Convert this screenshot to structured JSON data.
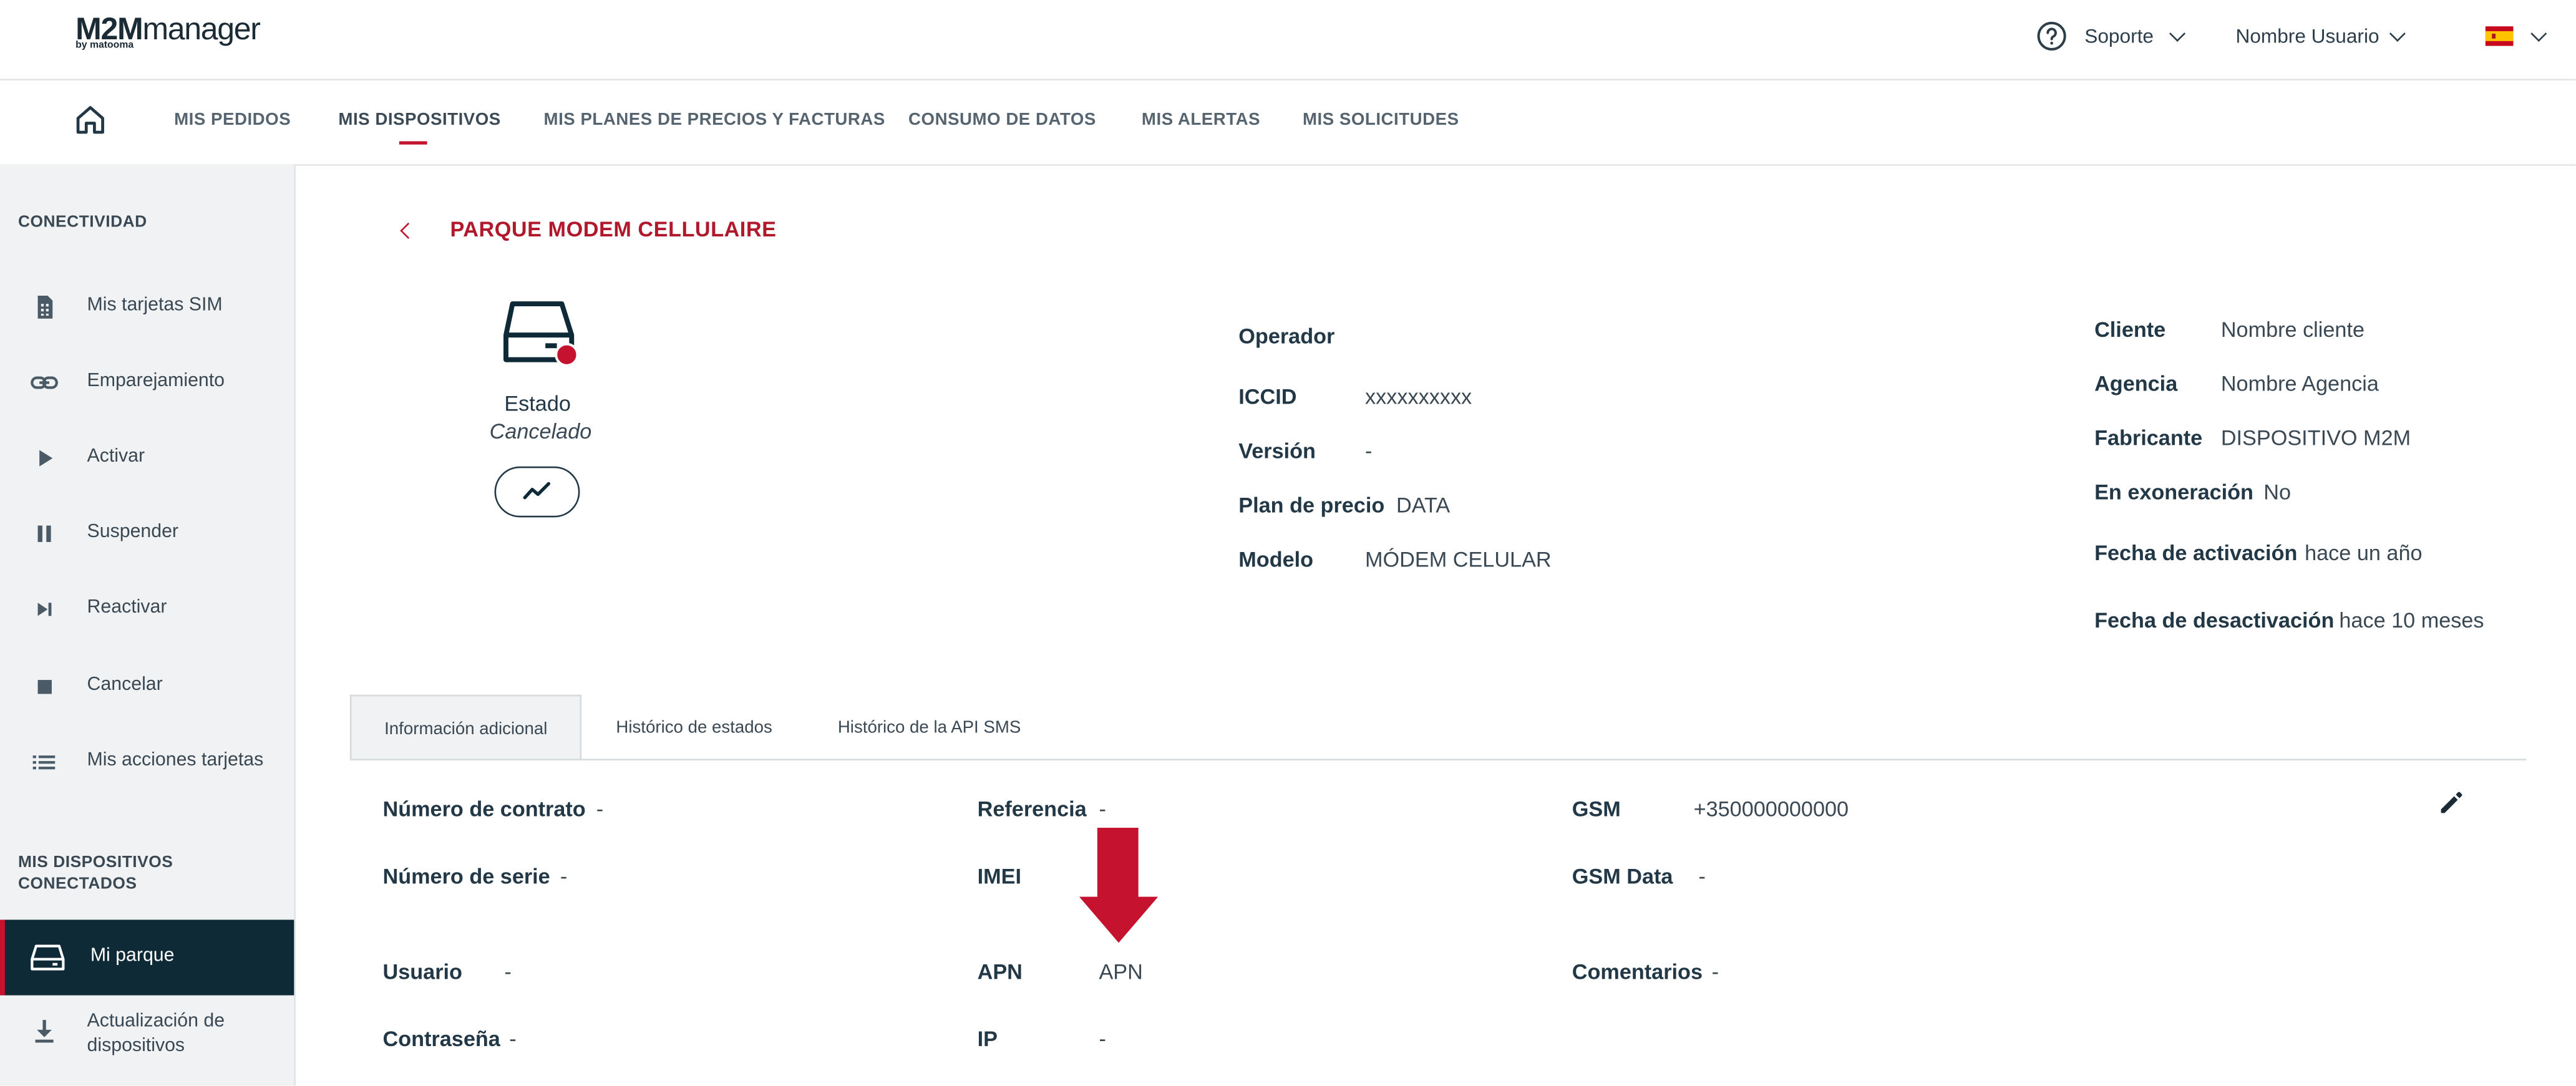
{
  "brand": {
    "logo_bold": "M2M",
    "logo_thin": "manager",
    "logo_sub": "by matooma"
  },
  "header": {
    "support_label": "Soporte",
    "user_label": "Nombre Usuario",
    "language": "es"
  },
  "nav": {
    "items": [
      {
        "label": "MIS PEDIDOS"
      },
      {
        "label": "MIS DISPOSITIVOS"
      },
      {
        "label": "MIS PLANES DE PRECIOS Y FACTURAS"
      },
      {
        "label": "CONSUMO DE DATOS"
      },
      {
        "label": "MIS ALERTAS"
      },
      {
        "label": "MIS SOLICITUDES"
      }
    ],
    "active": "MIS DISPOSITIVOS"
  },
  "sidebar": {
    "section1": "CONECTIVIDAD",
    "items": [
      {
        "label": "Mis tarjetas SIM",
        "icon": "sim-card-icon"
      },
      {
        "label": "Emparejamiento",
        "icon": "link-icon"
      },
      {
        "label": "Activar",
        "icon": "play-icon"
      },
      {
        "label": "Suspender",
        "icon": "pause-icon"
      },
      {
        "label": "Reactivar",
        "icon": "skip-next-icon"
      },
      {
        "label": "Cancelar",
        "icon": "stop-icon"
      },
      {
        "label": "Mis acciones tarjetas",
        "icon": "list-icon"
      }
    ],
    "section2_line1": "MIS DISPOSITIVOS",
    "section2_line2": "CONECTADOS",
    "items2": [
      {
        "label": "Mi parque",
        "icon": "device-icon",
        "active": true
      },
      {
        "label_line1": "Actualización de",
        "label_line2": "dispositivos",
        "icon": "download-icon"
      }
    ]
  },
  "page": {
    "title": "PARQUE MODEM CELLULAIRE",
    "device": {
      "state_label": "Estado",
      "state_value": "Cancelado"
    },
    "col2": {
      "operador_label": "Operador",
      "iccid_label": "ICCID",
      "iccid_value": "xxxxxxxxxx",
      "version_label": "Versión",
      "version_value": "-",
      "plan_label": "Plan de precio",
      "plan_value": "DATA",
      "modelo_label": "Modelo",
      "modelo_value": "MÓDEM CELULAR"
    },
    "col3": {
      "cliente_label": "Cliente",
      "cliente_value": "Nombre cliente",
      "agencia_label": "Agencia",
      "agencia_value": "Nombre Agencia",
      "fabricante_label": "Fabricante",
      "fabricante_value": "DISPOSITIVO M2M",
      "exoneracion_label": "En exoneración",
      "exoneracion_value": "No",
      "activacion_label": "Fecha de activación",
      "activacion_value": "hace un año",
      "desactivacion_label": "Fecha de desactivación",
      "desactivacion_value": "hace 10 meses"
    },
    "tabs": [
      {
        "label": "Información adicional"
      },
      {
        "label": "Histórico de estados"
      },
      {
        "label": "Histórico de la API SMS"
      }
    ],
    "info": {
      "contrato_label": "Número de contrato",
      "contrato_value": "-",
      "serie_label": "Número de serie",
      "serie_value": "-",
      "usuario_label": "Usuario",
      "usuario_value": "-",
      "contrasena_label": "Contraseña",
      "contrasena_value": "-",
      "referencia_label": "Referencia",
      "referencia_value": "-",
      "imei_label": "IMEI",
      "apn_label": "APN",
      "apn_value": "APN",
      "ip_label": "IP",
      "ip_value": "-",
      "gsm_label": "GSM",
      "gsm_value": "+350000000000",
      "gsmdata_label": "GSM Data",
      "gsmdata_value": "-",
      "comentarios_label": "Comentarios",
      "comentarios_value": "-"
    }
  },
  "colors": {
    "accent": "#c4122f",
    "dark": "#0e2a36",
    "sidebar_bg": "#f0f2f3"
  }
}
